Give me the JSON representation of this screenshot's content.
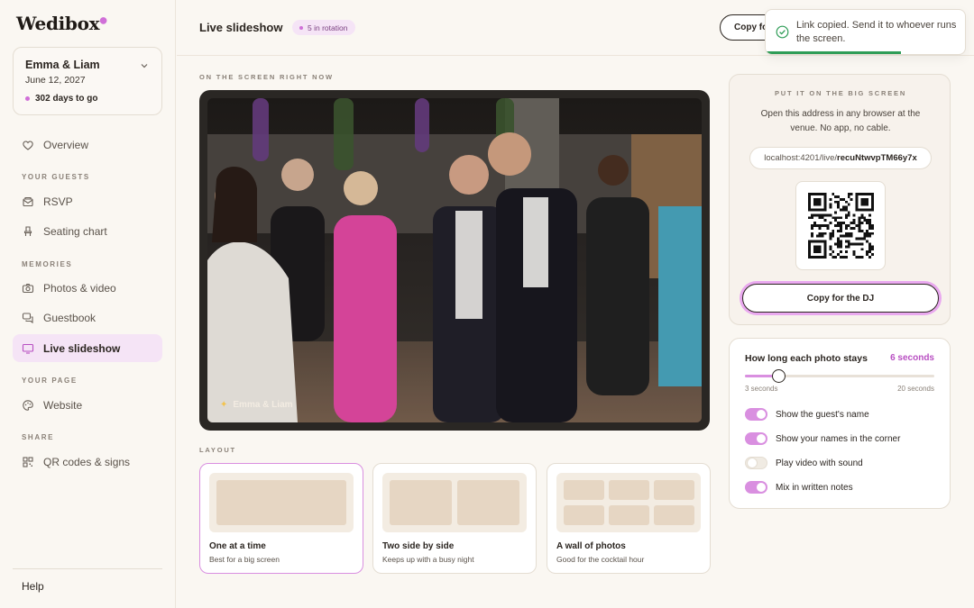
{
  "app": {
    "logo": "Wedibox"
  },
  "event": {
    "couple": "Emma & Liam",
    "date": "June 12, 2027",
    "countdown": "302 days to go"
  },
  "sidebar": {
    "overview": "Overview",
    "section_guests": "YOUR GUESTS",
    "rsvp": "RSVP",
    "seating": "Seating chart",
    "section_memories": "MEMORIES",
    "photos": "Photos & video",
    "guestbook": "Guestbook",
    "slideshow": "Live slideshow",
    "section_page": "YOUR PAGE",
    "website": "Website",
    "section_share": "SHARE",
    "qr": "QR codes & signs",
    "help": "Help"
  },
  "header": {
    "title": "Live slideshow",
    "badge": "5 in rotation",
    "copy_button": "Copy for the DJ"
  },
  "toast": {
    "message": "Link copied. Send it to whoever runs the screen."
  },
  "stage": {
    "eyebrow": "ON THE SCREEN RIGHT NOW",
    "credit": "Emma & Liam"
  },
  "layout": {
    "eyebrow": "LAYOUT",
    "options": [
      {
        "title": "One at a time",
        "subtitle": "Best for a big screen",
        "selected": true
      },
      {
        "title": "Two side by side",
        "subtitle": "Keeps up with a busy night",
        "selected": false
      },
      {
        "title": "A wall of photos",
        "subtitle": "Good for the cocktail hour",
        "selected": false
      }
    ]
  },
  "share_panel": {
    "eyebrow": "PUT IT ON THE BIG SCREEN",
    "description": "Open this address in any browser at the venue. No app, no cable.",
    "url_prefix": "localhost:4201/live/",
    "url_code": "recuNtwvpTM66y7x",
    "copy_button": "Copy for the DJ"
  },
  "timing": {
    "label": "How long each photo stays",
    "value_text": "6 seconds",
    "value": 6,
    "min": 3,
    "max": 20,
    "min_label": "3 seconds",
    "max_label": "20 seconds"
  },
  "toggles": [
    {
      "label": "Show the guest's name",
      "on": true
    },
    {
      "label": "Show your names in the corner",
      "on": true
    },
    {
      "label": "Play video with sound",
      "on": false
    },
    {
      "label": "Mix in written notes",
      "on": true
    }
  ],
  "colors": {
    "accent": "#d98fe0",
    "accent_text": "#b84fc2",
    "success": "#2f9d57"
  }
}
